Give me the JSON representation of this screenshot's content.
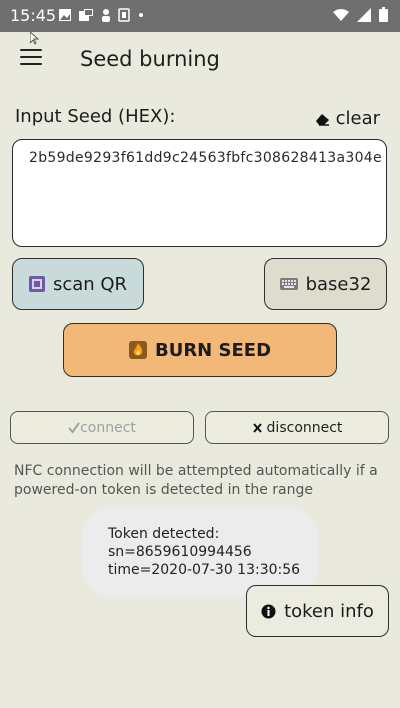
{
  "status_bar": {
    "time": "15:45",
    "icons": [
      "image-icon",
      "notification-icon",
      "person-icon",
      "sim-card-icon",
      "dot-icon"
    ],
    "right_icons": [
      "signal-icon",
      "wifi-icon",
      "battery-icon"
    ]
  },
  "app_bar": {
    "menu_icon": "hamburger-icon",
    "title": "Seed burning"
  },
  "seed_input": {
    "label": "Input Seed (HEX):",
    "clear_label": "clear",
    "value": "2b59de9293f61dd9c24563fbfc308628413a304e"
  },
  "buttons": {
    "scan_qr": "scan QR",
    "base32": "base32",
    "burn_seed": "BURN SEED",
    "connect": "connect",
    "disconnect": "disconnect",
    "token_info": "token info"
  },
  "nfc_note": "NFC connection will be attempted automatically if a powered-on token is detected in the range",
  "toast": {
    "line1": "Token detected:",
    "line2": "sn=8659610994456",
    "line3": "time=2020-07-30 13:30:56"
  },
  "colors": {
    "background": "#e9e9dd",
    "status_bar": "#6f6f6f",
    "scan_button": "#c8dada",
    "base32_button": "#dedccc",
    "burn_button": "#f1b877"
  }
}
